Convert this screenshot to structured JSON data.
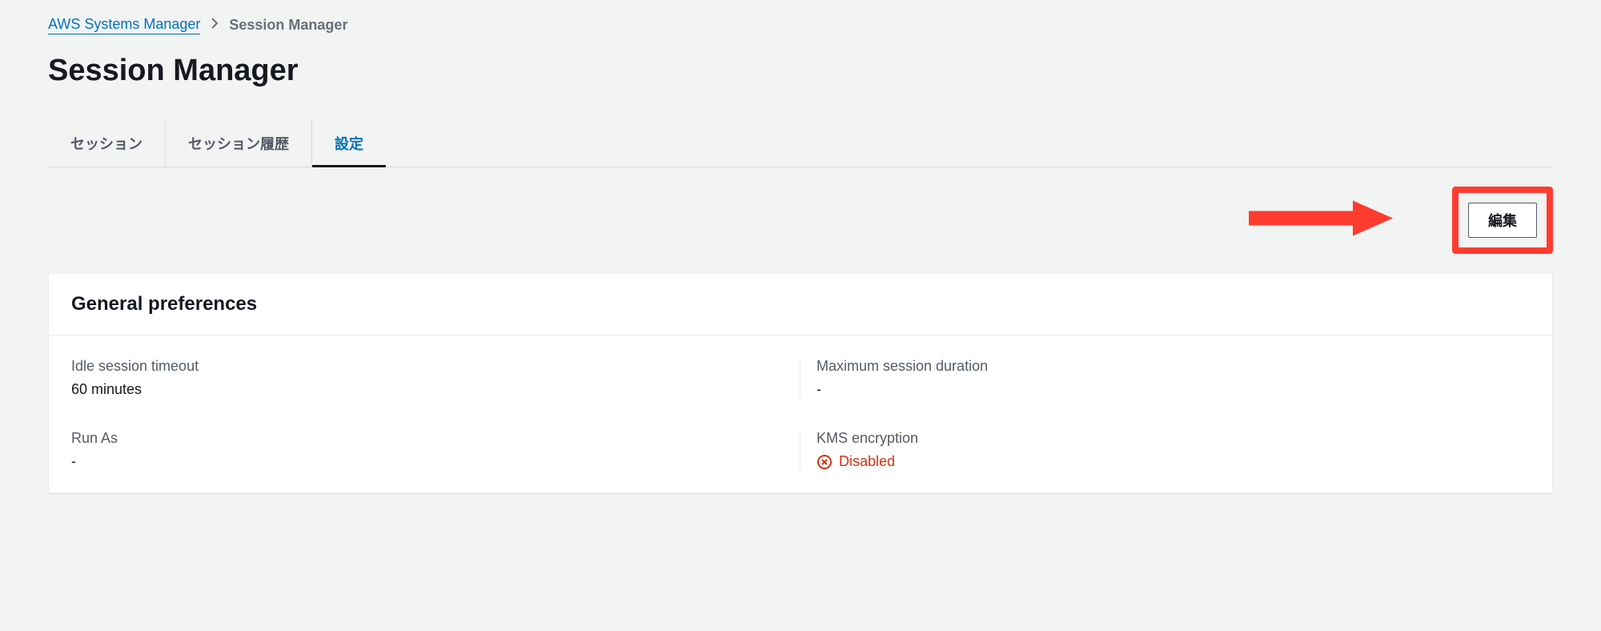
{
  "breadcrumb": {
    "root": "AWS Systems Manager",
    "current": "Session Manager"
  },
  "page_title": "Session Manager",
  "tabs": {
    "sessions": "セッション",
    "history": "セッション履歴",
    "settings": "設定"
  },
  "actions": {
    "edit": "編集"
  },
  "panel": {
    "title": "General preferences",
    "fields": {
      "idle_timeout_label": "Idle session timeout",
      "idle_timeout_value": "60 minutes",
      "max_duration_label": "Maximum session duration",
      "max_duration_value": "-",
      "run_as_label": "Run As",
      "run_as_value": "-",
      "kms_label": "KMS encryption",
      "kms_status": "Disabled"
    }
  }
}
